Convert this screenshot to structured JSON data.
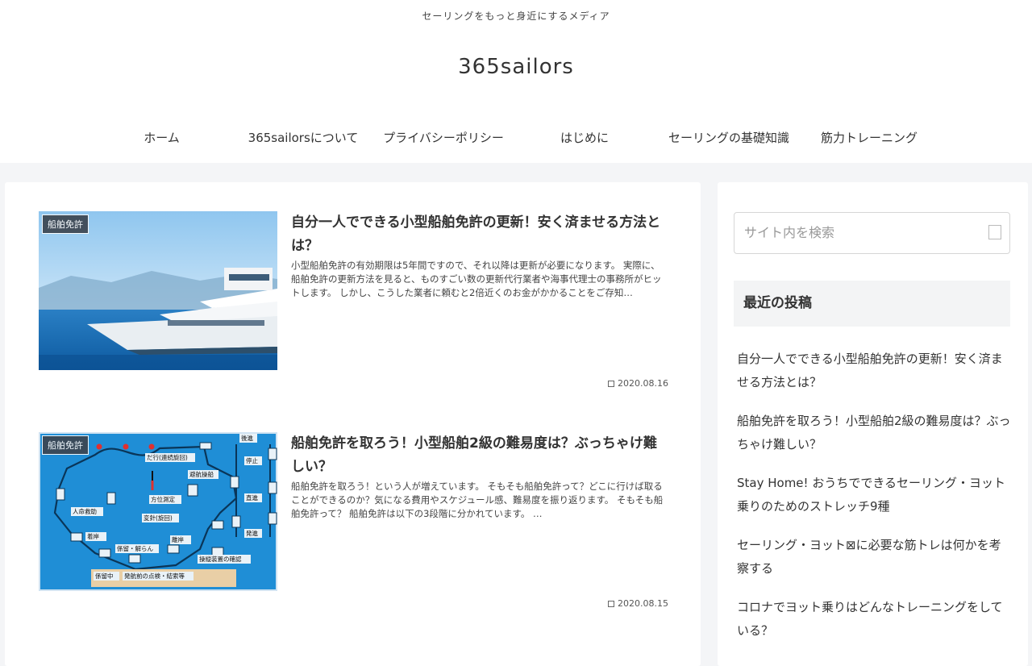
{
  "header": {
    "tagline": "セーリングをもっと身近にするメディア",
    "site_title": "365sailors"
  },
  "nav": {
    "items": [
      {
        "label": "ホーム"
      },
      {
        "label": "365sailorsについて"
      },
      {
        "label": "プライバシーポリシー"
      },
      {
        "label": "はじめに"
      },
      {
        "label": "セーリングの基礎知識"
      },
      {
        "label": "筋力トレーニング"
      }
    ]
  },
  "posts": [
    {
      "category": "船舶免許",
      "title": "自分一人でできる小型船舶免許の更新！安く済ませる方法とは？",
      "excerpt": "小型船舶免許の有効期限は5年間ですので、それ以降は更新が必要になります。 実際に、船舶免許の更新方法を見ると、ものすごい数の更新代行業者や海事代理士の事務所がヒットします。 しかし、こうした業者に頼むと2倍近くのお金がかかることをご存知…",
      "date": "2020.08.16"
    },
    {
      "category": "船舶免許",
      "title": "船舶免許を取ろう！小型船舶2級の難易度は？ぶっちゃけ難しい？",
      "excerpt": "船舶免許を取ろう！という人が増えています。 そもそも船舶免許って？どこに行けば取ることができるのか？気になる費用やスケジュール感、難易度を振り返ります。 そもそも船舶免許って？ 船舶免許は以下の3段階に分かれています。 …",
      "date": "2020.08.15",
      "diagram": {
        "labels": [
          "後進",
          "停止",
          "直進",
          "発進",
          "だ行(連続旋回)",
          "避航操船",
          "方位測定",
          "変針(旋回)",
          "人命救助",
          "着岸",
          "離岸",
          "係留・解らん",
          "操縦装置の確認",
          "係留中",
          "発航前の点検・結索等"
        ]
      }
    }
  ],
  "sidebar": {
    "search_placeholder": "サイト内を検索",
    "widget_title": "最近の投稿",
    "recent": [
      {
        "title": "自分一人でできる小型船舶免許の更新！安く済ませる方法とは？"
      },
      {
        "title": "船舶免許を取ろう！小型船舶2級の難易度は？ぶっちゃけ難しい？"
      },
      {
        "title": "Stay Home! おうちでできるセーリング・ヨット乗りのためのストレッチ9種"
      },
      {
        "title": "セーリング・ヨット⊠に必要な筋トレは何かを考察する"
      },
      {
        "title": "コロナでヨット乗りはどんなトレーニングをしている？"
      }
    ]
  },
  "colors": {
    "accent_dark": "#3c4550",
    "background": "#f4f5f7"
  }
}
